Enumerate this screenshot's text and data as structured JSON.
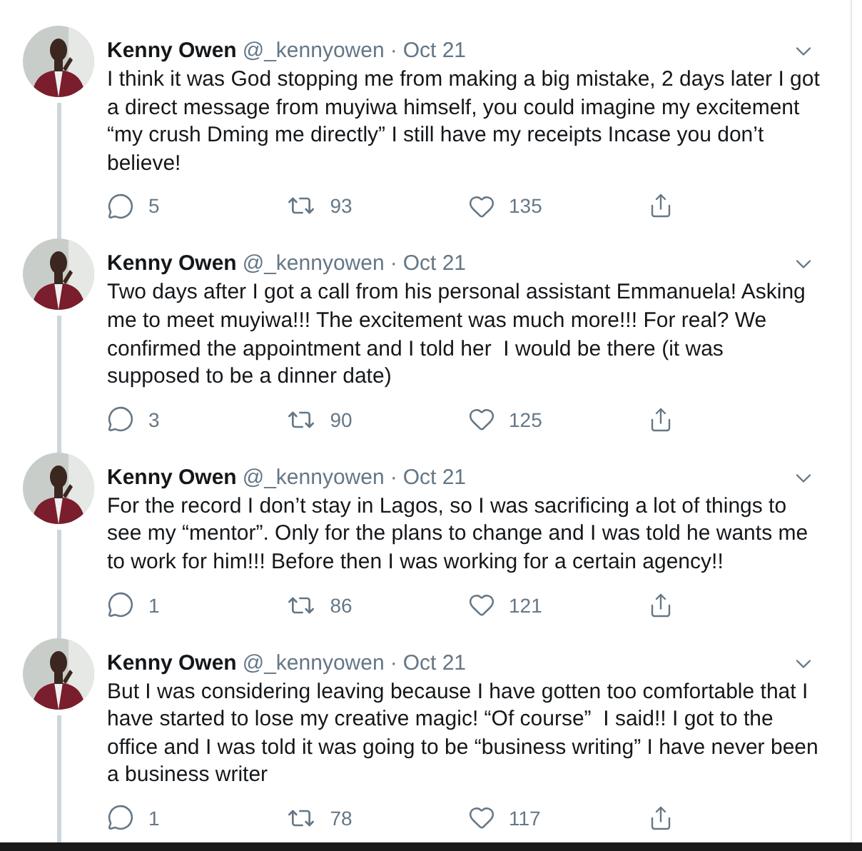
{
  "tweets": [
    {
      "name": "Kenny Owen",
      "handle": "@_kennyowen",
      "separator": "·",
      "date": "Oct 21",
      "text": "I think it was God stopping me from making a big mistake, 2 days later I got a direct message from muyiwa himself, you could imagine my excitement “my crush Dming me directly” I still have my receipts Incase you don’t believe!",
      "replies": "5",
      "retweets": "93",
      "likes": "135"
    },
    {
      "name": "Kenny Owen",
      "handle": "@_kennyowen",
      "separator": "·",
      "date": "Oct 21",
      "text": "Two days after I got a call from his personal assistant Emmanuela! Asking me to meet muyiwa!!! The excitement was much more!!! For real? We confirmed the appointment and I told her  I would be there (it was supposed to be a dinner date)",
      "replies": "3",
      "retweets": "90",
      "likes": "125"
    },
    {
      "name": "Kenny Owen",
      "handle": "@_kennyowen",
      "separator": "·",
      "date": "Oct 21",
      "text": "For the record I don’t stay in Lagos, so I was sacrificing a lot of things to see my “mentor”. Only for the plans to change and I was told he wants me to work for him!!! Before then I was working for a certain agency!!",
      "replies": "1",
      "retweets": "86",
      "likes": "121"
    },
    {
      "name": "Kenny Owen",
      "handle": "@_kennyowen",
      "separator": "·",
      "date": "Oct 21",
      "text": "But I was considering leaving because I have gotten too comfortable that I have started to lose my creative magic! “Of course”  I said!! I got to the office and I was told it was going to be “business writing” I have never been a business writer",
      "replies": "1",
      "retweets": "78",
      "likes": "117"
    }
  ]
}
